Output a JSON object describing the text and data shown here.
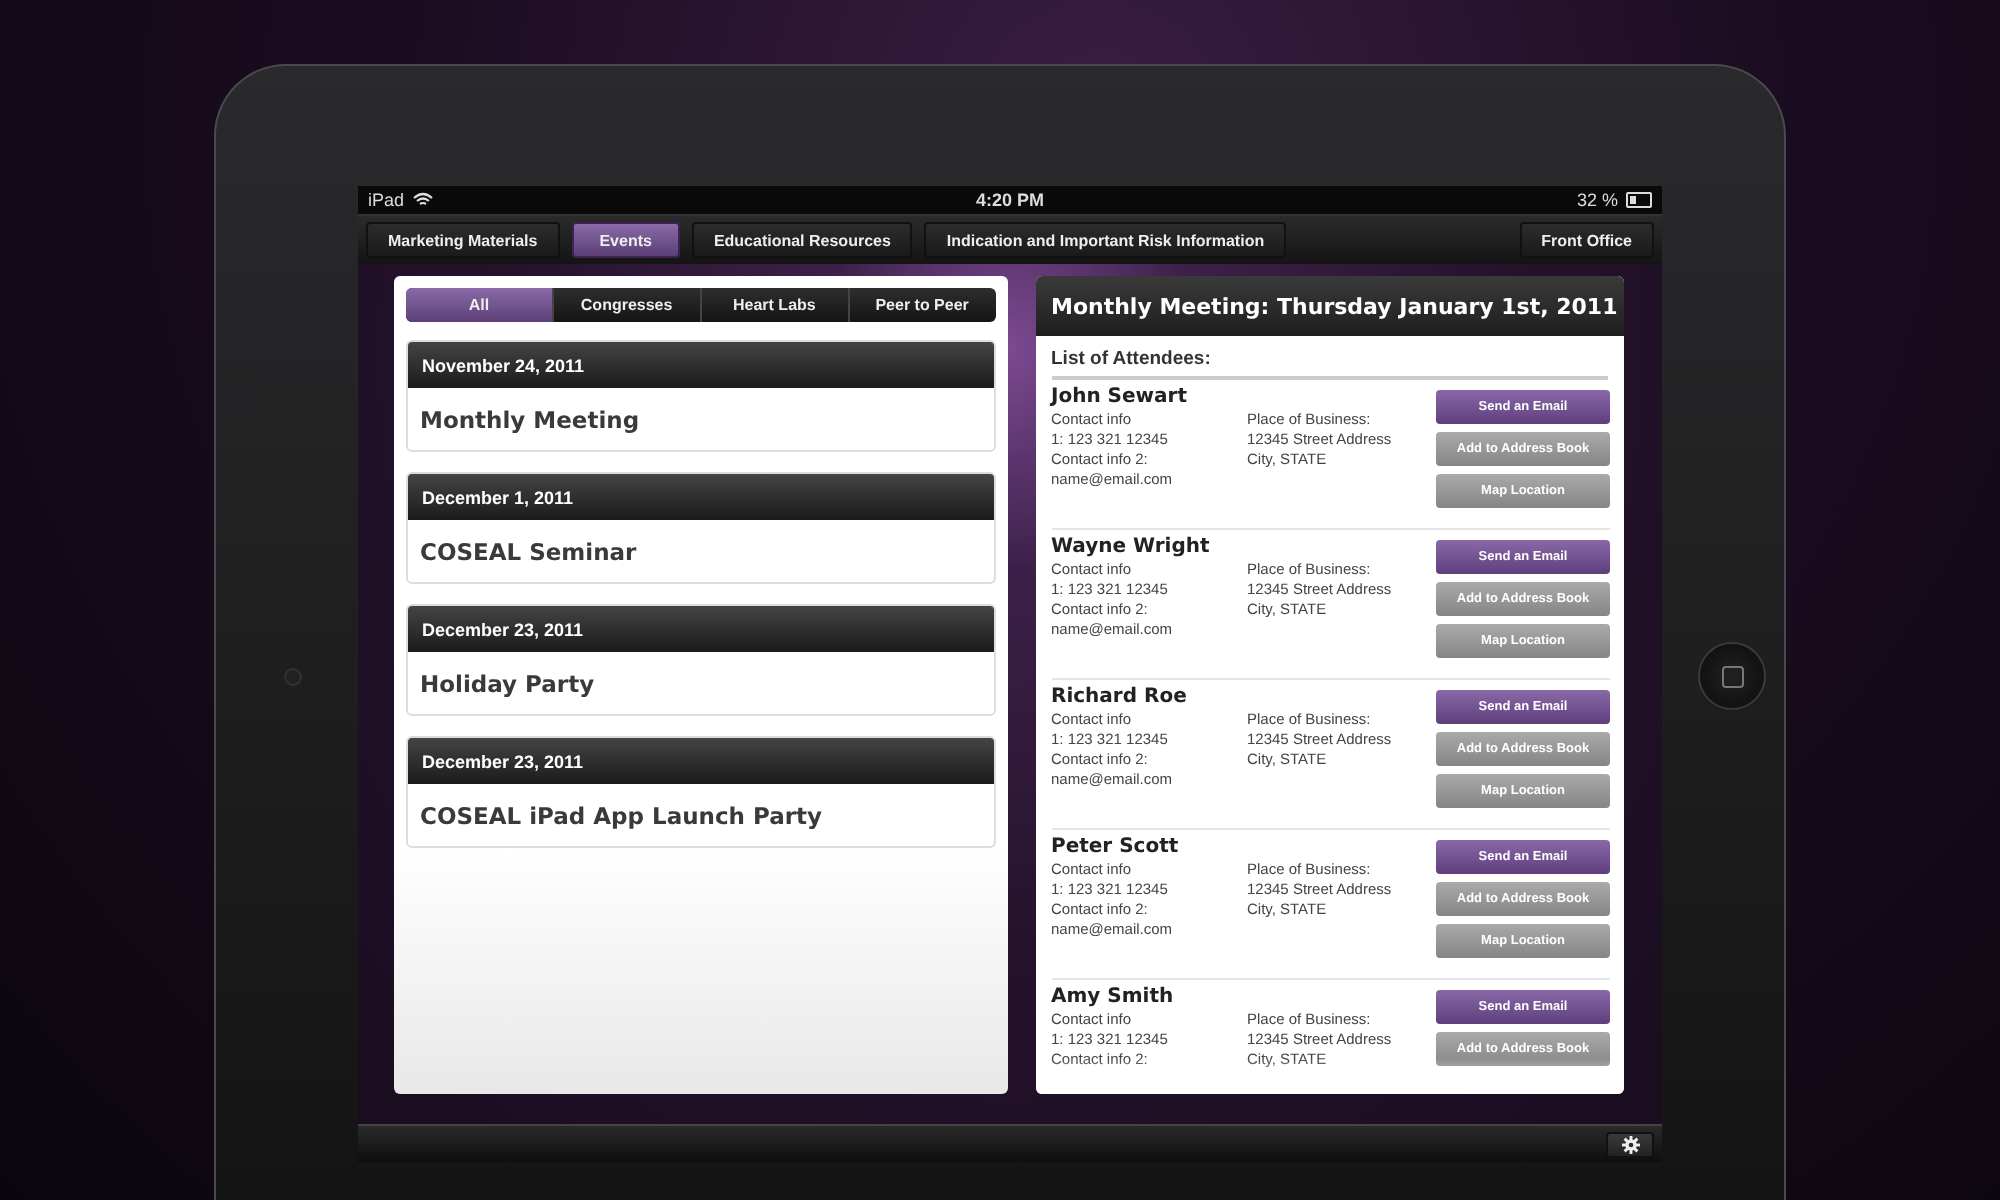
{
  "status_bar": {
    "device": "iPad",
    "time": "4:20 PM",
    "battery": "32 %"
  },
  "nav": {
    "tabs": [
      {
        "label": "Marketing Materials",
        "selected": false
      },
      {
        "label": "Events",
        "selected": true
      },
      {
        "label": "Educational Resources",
        "selected": false
      },
      {
        "label": "Indication and Important Risk Information",
        "selected": false
      }
    ],
    "front_office": "Front Office"
  },
  "filters": [
    {
      "label": "All",
      "selected": true
    },
    {
      "label": "Congresses",
      "selected": false
    },
    {
      "label": "Heart Labs",
      "selected": false
    },
    {
      "label": "Peer to Peer",
      "selected": false
    }
  ],
  "events": [
    {
      "date": "November 24, 2011",
      "title": "Monthly Meeting"
    },
    {
      "date": "December 1, 2011",
      "title": "COSEAL Seminar"
    },
    {
      "date": "December 23, 2011",
      "title": "Holiday Party"
    },
    {
      "date": "December 23, 2011",
      "title": "COSEAL iPad App Launch Party"
    }
  ],
  "detail": {
    "title": "Monthly Meeting: Thursday January 1st, 2011",
    "section": "List of Attendees:",
    "attendees": [
      {
        "name": "John Sewart",
        "contact": [
          "Contact info",
          "1: 123 321 12345",
          "Contact info 2:",
          "name@email.com"
        ],
        "business": [
          "Place of Business:",
          "12345 Street Address",
          "City, STATE"
        ],
        "buttons": [
          {
            "label": "Send an Email",
            "kind": "primary"
          },
          {
            "label": "Add to Address Book",
            "kind": "secondary"
          },
          {
            "label": "Map Location",
            "kind": "secondary"
          }
        ]
      },
      {
        "name": "Wayne Wright",
        "contact": [
          "Contact info",
          "1: 123 321 12345",
          "Contact info 2:",
          "name@email.com"
        ],
        "business": [
          "Place of Business:",
          "12345 Street Address",
          "City, STATE"
        ],
        "buttons": [
          {
            "label": "Send an Email",
            "kind": "primary"
          },
          {
            "label": "Add to Address Book",
            "kind": "secondary"
          },
          {
            "label": "Map Location",
            "kind": "secondary"
          }
        ]
      },
      {
        "name": "Richard Roe",
        "contact": [
          "Contact info",
          "1: 123 321 12345",
          "Contact info 2:",
          "name@email.com"
        ],
        "business": [
          "Place of Business:",
          "12345 Street Address",
          "City, STATE"
        ],
        "buttons": [
          {
            "label": "Send an Email",
            "kind": "primary"
          },
          {
            "label": "Add to Address Book",
            "kind": "secondary"
          },
          {
            "label": "Map Location",
            "kind": "secondary"
          }
        ]
      },
      {
        "name": "Peter Scott",
        "contact": [
          "Contact info",
          "1: 123 321 12345",
          "Contact info 2:",
          "name@email.com"
        ],
        "business": [
          "Place of Business:",
          "12345 Street Address",
          "City, STATE"
        ],
        "buttons": [
          {
            "label": "Send an Email",
            "kind": "primary"
          },
          {
            "label": "Add to Address Book",
            "kind": "secondary"
          },
          {
            "label": "Map Location",
            "kind": "secondary"
          }
        ]
      },
      {
        "name": "Amy Smith",
        "contact": [
          "Contact info",
          "1: 123 321 12345",
          "Contact info 2:"
        ],
        "business": [
          "Place of Business:",
          "12345 Street Address",
          "City, STATE"
        ],
        "buttons": [
          {
            "label": "Send an Email",
            "kind": "primary"
          },
          {
            "label": "Add to Address Book",
            "kind": "secondary"
          }
        ]
      }
    ]
  }
}
